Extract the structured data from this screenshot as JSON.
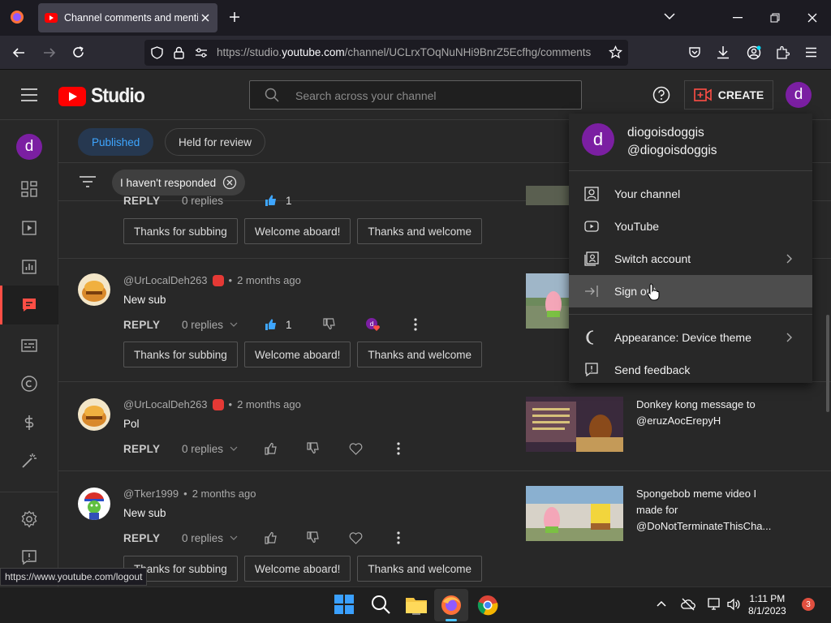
{
  "browser": {
    "tab_title": "Channel comments and mentions",
    "url_prefix": "https://studio.",
    "url_domain": "youtube.com",
    "url_rest": "/channel/UCLrxTOqNuNHi9BnrZ5Ecfhg/comments"
  },
  "header": {
    "logo_text": "Studio",
    "search_placeholder": "Search across your channel",
    "create_label": "CREATE",
    "avatar_letter": "d"
  },
  "rail": {
    "avatar_letter": "d"
  },
  "tabs": {
    "published": "Published",
    "held": "Held for review"
  },
  "filter": {
    "chip_label": "I haven't responded"
  },
  "quick_replies": [
    "Thanks for subbing",
    "Welcome aboard!",
    "Thanks and welcome"
  ],
  "partial_row": {
    "reply": "REPLY",
    "replies": "0 replies",
    "likes": "1"
  },
  "comments": [
    {
      "author": "@UrLocalDeh263",
      "time": "2 months ago",
      "text": "New sub",
      "reply": "REPLY",
      "replies": "0 replies",
      "likes": "1"
    },
    {
      "author": "@UrLocalDeh263",
      "time": "2 months ago",
      "text": "Pol",
      "reply": "REPLY",
      "replies": "0 replies",
      "video_title": "Donkey kong message to @eruzAocErepyH"
    },
    {
      "author": "@Tker1999",
      "time": "2 months ago",
      "text": "New sub",
      "reply": "REPLY",
      "replies": "0 replies",
      "video_title": "Spongebob meme video I made for @DoNotTerminateThisCha..."
    }
  ],
  "account_menu": {
    "avatar_letter": "d",
    "name": "diogoisdoggis",
    "handle": "@diogoisdoggis",
    "items": {
      "your_channel": "Your channel",
      "youtube": "YouTube",
      "switch_account": "Switch account",
      "sign_out": "Sign out",
      "appearance": "Appearance: Device theme",
      "feedback": "Send feedback"
    }
  },
  "status_url": "https://www.youtube.com/logout",
  "taskbar": {
    "time": "1:11 PM",
    "date": "8/1/2023",
    "notifications": "3"
  },
  "colors": {
    "accent_red": "#ff0000",
    "avatar_purple": "#7b1fa2",
    "published_blue": "#3ea6ff",
    "like_blue": "#3ea6ff"
  }
}
